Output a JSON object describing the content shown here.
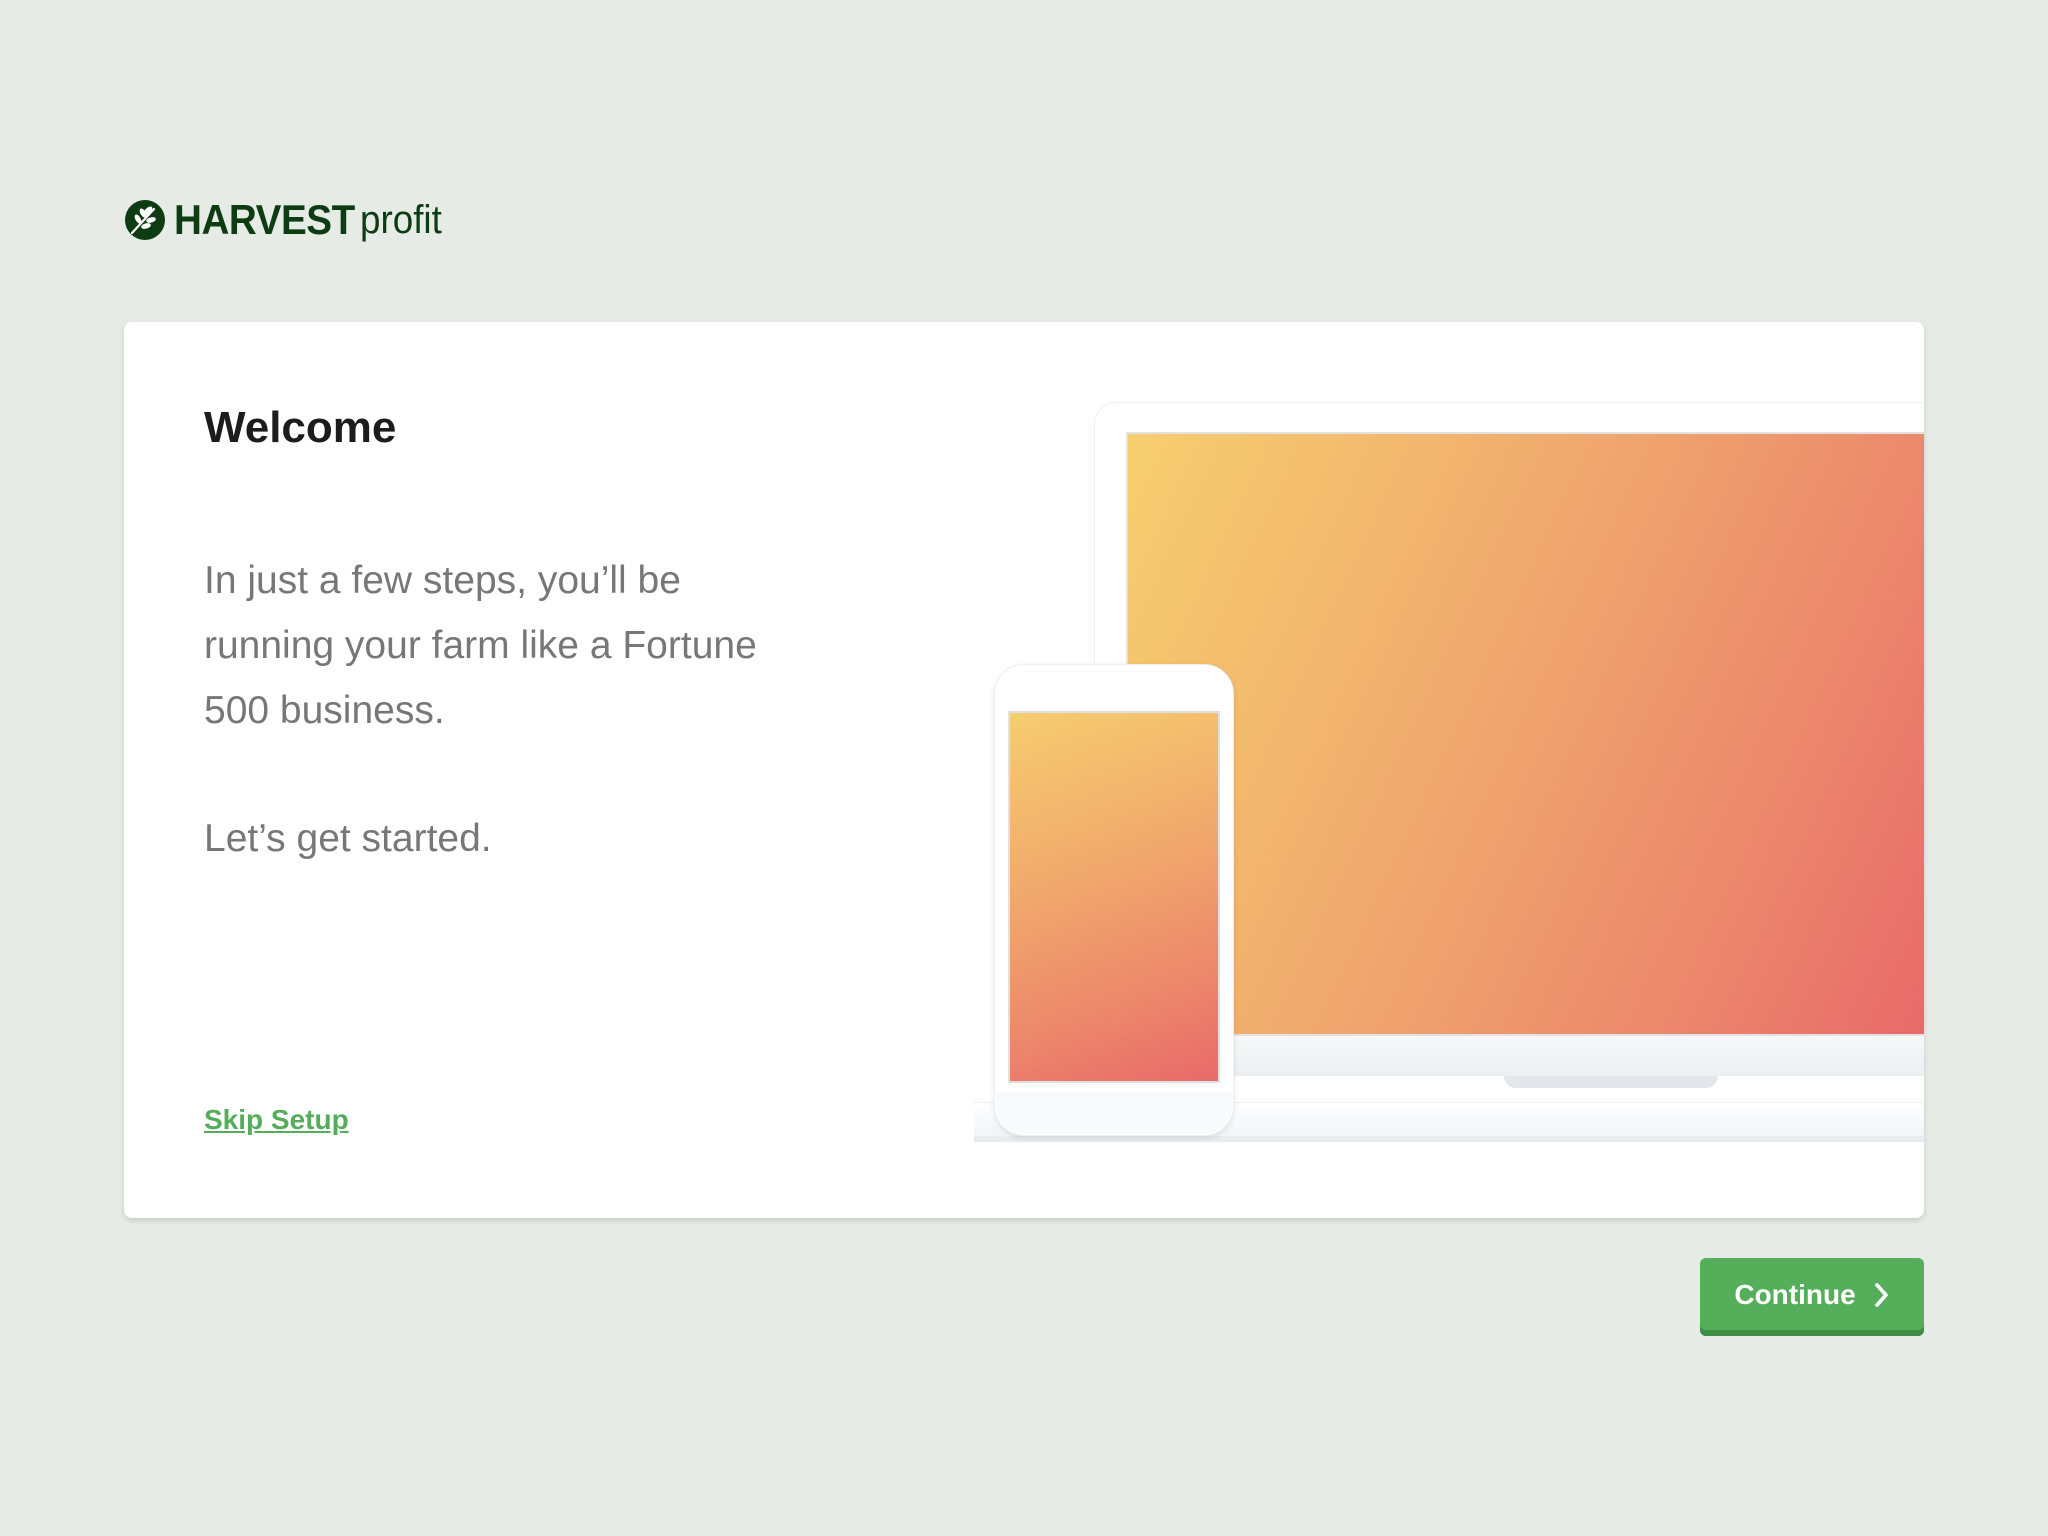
{
  "brand": {
    "name_bold": "HARVEST",
    "name_light": "profit",
    "logo_icon": "wheat-leaf-icon",
    "color": "#0d3b12"
  },
  "welcome": {
    "title": "Welcome",
    "intro": "In just a few steps, you’ll be running your farm like a Fortune 500 business.",
    "cta_text": "Let’s get started."
  },
  "links": {
    "skip_label": "Skip Setup"
  },
  "buttons": {
    "continue_label": "Continue",
    "continue_icon": "chevron-right-icon"
  },
  "colors": {
    "background": "#e6ebe5",
    "accent_green": "#55ae5a",
    "gradient_start": "#f6cf6f",
    "gradient_end": "#e8686a"
  }
}
